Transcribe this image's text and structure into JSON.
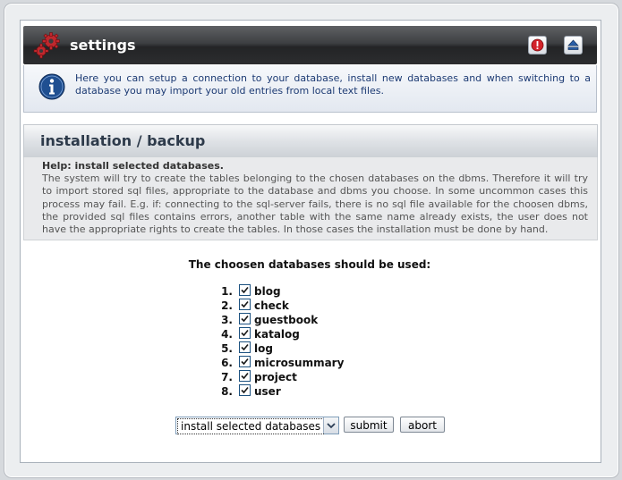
{
  "header": {
    "title": "settings",
    "icons": [
      "gears-icon",
      "info-alert-icon",
      "eject-icon"
    ]
  },
  "info": {
    "text": "Here you can setup a connection to your database, install new databases and when switching to a database you may import your old entries from local text files."
  },
  "section": {
    "title": "installation / backup",
    "help_title": "Help:  install selected databases.",
    "help_text": "The system will try to create the tables belonging to the chosen databases on the dbms. Therefore it will try to import stored sql files, appropriate to the database and dbms you choose. In some uncommon cases this process may fail. E.g. if: connecting to the sql-server fails, there is no sql file available for the choosen dbms, the provided sql files contains errors, another table with the same name already exists, the user does not have the appropriate rights to create the tables. In those cases the installation must be done by hand."
  },
  "form": {
    "question": "The choosen databases should be used:",
    "databases": [
      {
        "num": "1.",
        "label": "blog",
        "checked": true
      },
      {
        "num": "2.",
        "label": "check",
        "checked": true
      },
      {
        "num": "3.",
        "label": "guestbook",
        "checked": true
      },
      {
        "num": "4.",
        "label": "katalog",
        "checked": true
      },
      {
        "num": "5.",
        "label": "log",
        "checked": true
      },
      {
        "num": "6.",
        "label": "microsummary",
        "checked": true
      },
      {
        "num": "7.",
        "label": "project",
        "checked": true
      },
      {
        "num": "8.",
        "label": "user",
        "checked": true
      }
    ],
    "action_select": "install selected databases",
    "submit_label": "submit",
    "abort_label": "abort"
  },
  "colors": {
    "header_bg": "#2c2d2f",
    "info_text": "#1c3a73",
    "alert_red": "#d3232a",
    "accent_blue": "#2a5fa8"
  }
}
